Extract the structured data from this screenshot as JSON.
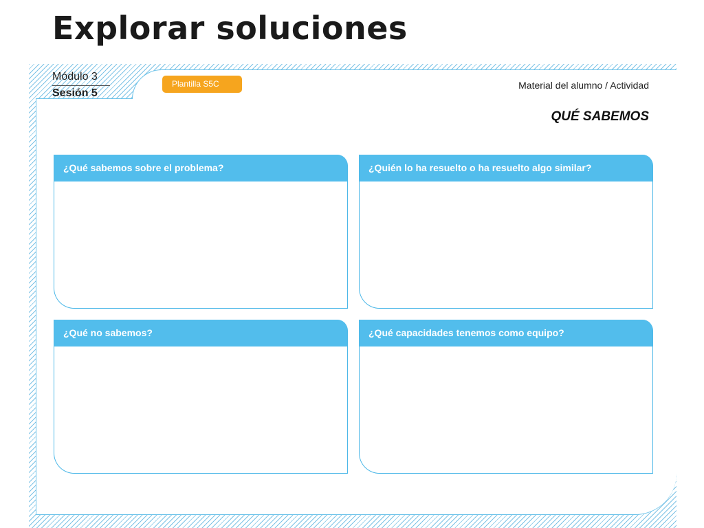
{
  "slide": {
    "title": "Explorar soluciones"
  },
  "header": {
    "modulo": "Módulo 3",
    "sesion": "Sesión 5",
    "tag": "Plantilla S5C",
    "material": "Material del alumno / Actividad"
  },
  "section": {
    "heading": "QUÉ SABEMOS"
  },
  "boxes": [
    {
      "question": "¿Qué sabemos sobre el problema?"
    },
    {
      "question": "¿Quién lo ha resuelto o ha resuelto algo similar?"
    },
    {
      "question": "¿Qué no sabemos?"
    },
    {
      "question": "¿Qué capacidades tenemos como equipo?"
    }
  ],
  "colors": {
    "accent_blue": "#52bdec",
    "tag_orange": "#f6a51e",
    "border_blue": "#6cc3ea"
  }
}
